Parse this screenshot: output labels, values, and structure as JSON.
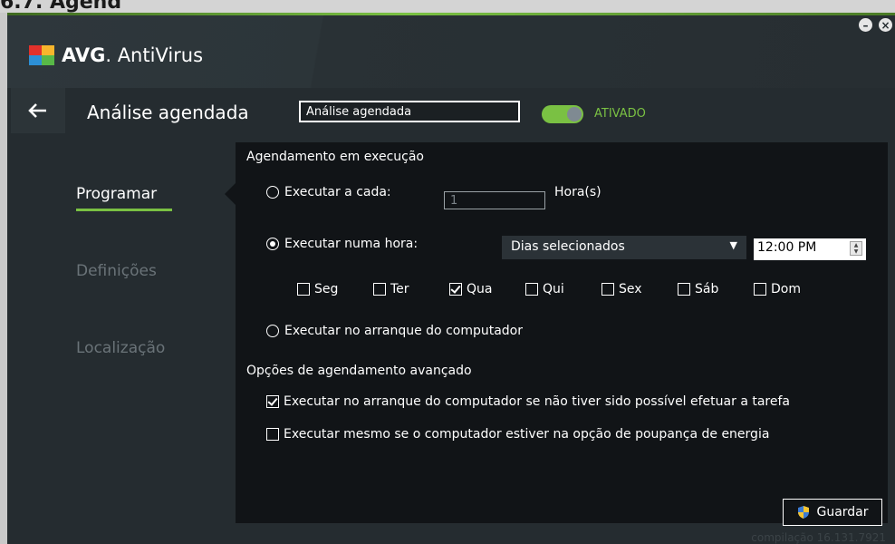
{
  "app": {
    "brand": "AVG",
    "product": "AntiVirus"
  },
  "window_controls": {
    "minimize": "–",
    "close": "×"
  },
  "header": {
    "back_icon": "arrow-left-icon",
    "title": "Análise agendada",
    "name_field_value": "Análise agendada",
    "toggle_on": true,
    "toggle_label": "ATIVADO"
  },
  "sidebar": {
    "items": [
      {
        "label": "Programar",
        "active": true
      },
      {
        "label": "Definições",
        "active": false
      },
      {
        "label": "Localização",
        "active": false
      }
    ]
  },
  "schedule": {
    "section_title": "Agendamento em execução",
    "every": {
      "label": "Executar a cada:",
      "value": "1",
      "unit": "Hora(s)",
      "selected": false
    },
    "at_time": {
      "label": "Executar numa hora:",
      "selected": true,
      "dropdown_value": "Dias selecionados",
      "time_value": "12:00 PM"
    },
    "days": [
      {
        "label": "Seg",
        "checked": false
      },
      {
        "label": "Ter",
        "checked": false
      },
      {
        "label": "Qua",
        "checked": true
      },
      {
        "label": "Qui",
        "checked": false
      },
      {
        "label": "Sex",
        "checked": false
      },
      {
        "label": "Sáb",
        "checked": false
      },
      {
        "label": "Dom",
        "checked": false
      }
    ],
    "startup": {
      "label": "Executar no arranque do computador",
      "selected": false
    }
  },
  "advanced": {
    "section_title": "Opções de agendamento avançado",
    "options": [
      {
        "label": "Executar no arranque do computador se não tiver sido possível efetuar a tarefa",
        "checked": true
      },
      {
        "label": "Executar mesmo se o computador estiver na opção de poupança de energia",
        "checked": false
      }
    ]
  },
  "footer": {
    "save_label": "Guardar",
    "build_label": "compilação 16.131.7921"
  },
  "colors": {
    "accent": "#7ac143",
    "panel": "#111417",
    "window": "#252c30"
  }
}
